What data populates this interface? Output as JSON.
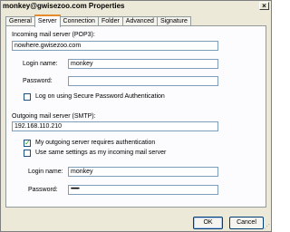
{
  "window": {
    "title": "monkey@gwisezoo.com Properties",
    "close": "×"
  },
  "tabs": [
    "General",
    "Server",
    "Connection",
    "Folder",
    "Advanced",
    "Signature"
  ],
  "incoming": {
    "header": "Incoming mail server (POP3):",
    "server": "nowhere.gwisezoo.com",
    "login_label": "Login name:",
    "login_value": "monkey",
    "password_label": "Password:",
    "password_value": "",
    "spa_label": "Log on using Secure Password Authentication",
    "spa_checked": false
  },
  "outgoing": {
    "header": "Outgoing mail server (SMTP):",
    "server": "192.168.110.210",
    "auth_label": "My outgoing server requires authentication",
    "auth_checked": true,
    "same_label": "Use same settings as my incoming mail server",
    "same_checked": false,
    "login_label": "Login name:",
    "login_value": "monkey",
    "password_label": "Password:",
    "password_value": "••••••••"
  },
  "buttons": {
    "ok": "OK",
    "cancel": "Cancel"
  }
}
